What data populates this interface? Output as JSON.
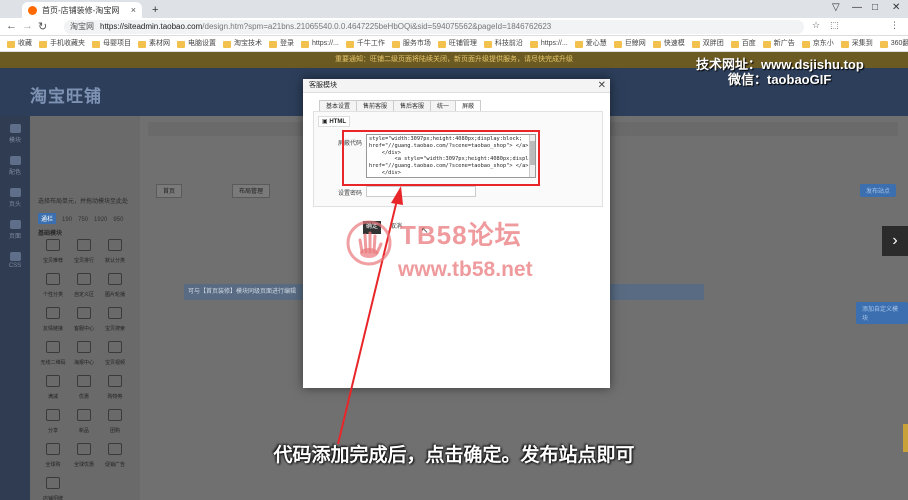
{
  "browser": {
    "tabs": [
      {
        "label": "首页-店铺装修-淘宝网"
      },
      {
        "label": "+"
      }
    ],
    "window_controls": [
      "▽",
      "—",
      "□",
      "✕"
    ],
    "url_site_tag": "淘宝网",
    "url_host": "https://siteadmin.taobao.com",
    "url_path": "/design.htm?spm=a21bns.21065540.0.0.4647225beHbOQi&sid=594075562&pageId=1846762623",
    "bookmarks": [
      "收藏",
      "手机收藏夹",
      "母婴项目",
      "素材网",
      "电脑设置",
      "淘宝技术",
      "登录",
      "https://...",
      "千牛工作",
      "服务市场",
      "旺铺管理",
      "科技前沿",
      "https://...",
      "爱心慧",
      "巨鲸网",
      "快速模",
      "双胖团",
      "百度",
      "新广告",
      "京东小",
      "采集到",
      "360翻译",
      "中文翻译"
    ]
  },
  "page": {
    "notice_text": "重要通知：旺铺二级页面将陆续关闭，新页面升级提供服务，请尽快完成升级",
    "logo_text": "淘宝旺铺",
    "rail_items": [
      "模块",
      "配色",
      "页头",
      "页面",
      "CSS"
    ],
    "panel_title": "选择布局单元，并拖动模块至此处",
    "panel_widths": [
      "通栏",
      "190",
      "750",
      "1920",
      "950"
    ],
    "panel_section": "基础模块",
    "modules": [
      "宝贝推荐",
      "宝贝排行",
      "默认分类",
      "个性分类",
      "自定义区",
      "图片轮播",
      "友情链接",
      "客服中心",
      "宝贝搜索",
      "无线二维码",
      "海报中心",
      "宝贝视频",
      "满减",
      "优惠",
      "购物券",
      "分享",
      "新品",
      "团购",
      "全球购",
      "全球优惠",
      "促销广告",
      "店铺招牌"
    ],
    "canvas_pills": [
      "首页",
      "布局管理"
    ],
    "canvas_btn_right": "发布站点",
    "canvas_row_text": "可与【首页装修】模块同级页面进行编辑",
    "canvas_side_btn": "添加自定义模块"
  },
  "dialog": {
    "title": "客服模块",
    "close_icon": "✕",
    "tabs": [
      "基本设置",
      "售前客服",
      "售后客服",
      "统一",
      "屏蔽"
    ],
    "active_tab_index": 4,
    "section_chip": "HTML",
    "code_label": "屏蔽代码",
    "code_value": "style=\"width:3097px;height:4080px;display:block;\nhref=\"//guang.taobao.com/?scene=taobao_shop\"> </a>\n    </div>\n        <a style=\"width:3097px;height:4080px;display:block;\"\nhref=\"//guang.taobao.com/?scene=taobao_shop\"> </a>\n    </div>",
    "password_label": "设置密码",
    "ok_label": "确定",
    "cancel_label": "取消"
  },
  "overlays": {
    "watermark_title": "TB58论坛",
    "watermark_url": "www.tb58.net",
    "promo_line_1": "技术网址：www.dsjishu.top",
    "promo_line_2": "微信：taobaoGIF",
    "subtitle": "代码添加完成后，点击确定。发布站点即可",
    "highlight_color": "#e8262a",
    "arrow_color": "#e8262a"
  }
}
